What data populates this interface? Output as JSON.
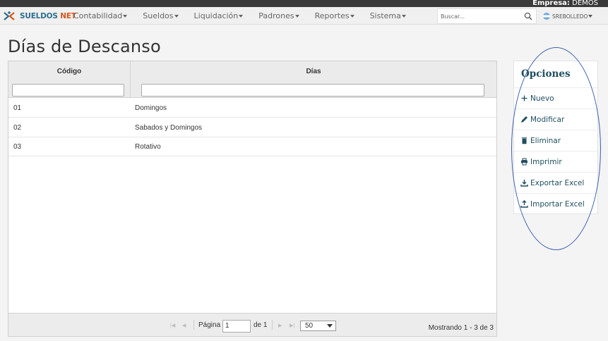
{
  "header": {
    "empresa_label": "Empresa:",
    "empresa_value": "DEMOS",
    "brand_part1": "SUELDOS",
    "brand_part2": "NET",
    "search_placeholder": "Buscar...",
    "user": "SREBOLLEDO"
  },
  "menu": [
    "Contabilidad",
    "Sueldos",
    "Liquidación",
    "Padrones",
    "Reportes",
    "Sistema"
  ],
  "page": {
    "title": "Días de Descanso"
  },
  "grid": {
    "columns": [
      "Código",
      "Días"
    ],
    "rows": [
      [
        "01",
        "Domingos"
      ],
      [
        "02",
        "Sabados y Domingos"
      ],
      [
        "03",
        "Rotativo"
      ]
    ],
    "pager": {
      "page_label": "Página",
      "page_value": "1",
      "of_label": "de 1",
      "page_size": "50",
      "info": "Mostrando 1 - 3 de 3"
    }
  },
  "options": {
    "title": "Opciones",
    "items": [
      "Nuevo",
      "Modificar",
      "Eliminar",
      "Imprimir",
      "Exportar Excel",
      "Importar Excel"
    ]
  },
  "colors": {
    "brand_blue": "#2e6f8e",
    "brand_orange": "#d35b22",
    "options_text": "#1f4e5f",
    "annotation_ellipse": "#3a5fb0"
  }
}
